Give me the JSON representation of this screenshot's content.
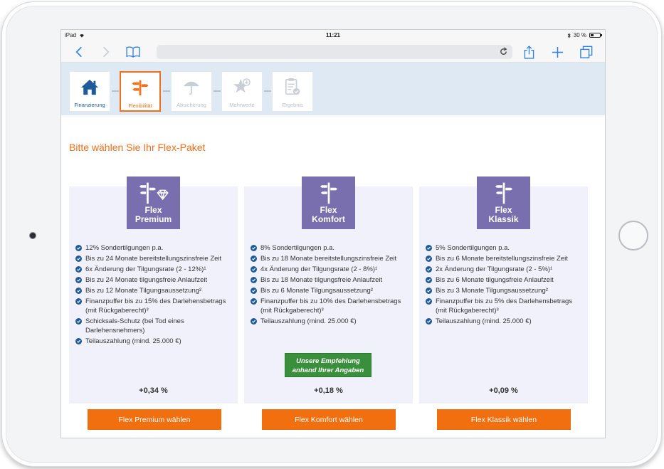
{
  "status": {
    "device": "iPad",
    "time": "11:21",
    "battery": "30 %"
  },
  "steps": [
    {
      "label": "Finanzierung",
      "state": "done",
      "icon": "house-icon"
    },
    {
      "label": "Flexibilität",
      "state": "active",
      "icon": "signpost-icon"
    },
    {
      "label": "Absicherung",
      "state": "inactive",
      "icon": "umbrella-icon"
    },
    {
      "label": "Mehrwerte",
      "state": "inactive",
      "icon": "star-plus-icon"
    },
    {
      "label": "Ergebnis",
      "state": "inactive",
      "icon": "clipboard-check-icon"
    }
  ],
  "heading": "Bitte wählen Sie Ihr Flex-Paket",
  "packages": [
    {
      "name1": "Flex",
      "name2": "Premium",
      "icon": "signpost-diamond-icon",
      "features": [
        "12% Sondertilgungen p.a.",
        "Bis zu 24 Monate bereitstellungszinsfreie Zeit",
        "6x Änderung der Tilgungsrate (2 - 12%)¹",
        "Bis zu 24 Monate tilgungsfreie Anlaufzeit",
        "Bis zu 12 Monate Tilgungsaussetzung²",
        "Finanzpuffer bis zu 15% des Darlehensbetrags (mit Rückgaberecht)³",
        "Schicksals-Schutz (bei Tod eines Darlehensnehmers)",
        "Teilauszahlung (mind. 25.000 €)"
      ],
      "recommendation": "",
      "rate": "+0,34  %",
      "button": "Flex Premium wählen"
    },
    {
      "name1": "Flex",
      "name2": "Komfort",
      "icon": "signpost-icon",
      "features": [
        "8% Sondertilgungen p.a.",
        "Bis zu 18 Monate bereitstellungszinsfreie Zeit",
        "4x Änderung der Tilgungsrate (2 - 8%)¹",
        "Bis zu 18 Monate tilgungsfreie Anlaufzeit",
        "Bis zu 6 Monate Tilgungsaussetzung²",
        "Finanzpuffer bis zu 10% des Darlehensbetrags (mit Rückgaberecht)³",
        "Teilauszahlung (mind. 25.000 €)"
      ],
      "recommendation": "Unsere Empfehlung anhand Ihrer Angaben",
      "rate": "+0,18  %",
      "button": "Flex Komfort wählen"
    },
    {
      "name1": "Flex",
      "name2": "Klassik",
      "icon": "signpost-icon",
      "features": [
        "5% Sondertilgungen p.a.",
        "Bis zu 6 Monate bereitstellungszinsfreie Zeit",
        "2x Änderung der Tilgungsrate (2 - 5%)¹",
        "Bis zu 6 Monate tilgungsfreie Anlaufzeit",
        "Bis zu 3 Monate Tilgungsaussetzung²",
        "Finanzpuffer bis zu 5% des Darlehensbetrags (mit Rückgaberecht)³",
        "Teilauszahlung (mind. 25.000 €)"
      ],
      "recommendation": "",
      "rate": "+0,09  %",
      "button": "Flex Klassik wählen"
    }
  ],
  "colors": {
    "accent": "#f26f1c",
    "badge": "#7a6fae",
    "primary": "#1f5b9b",
    "recommend": "#3a8f3c",
    "card": "#f1f1fb"
  }
}
